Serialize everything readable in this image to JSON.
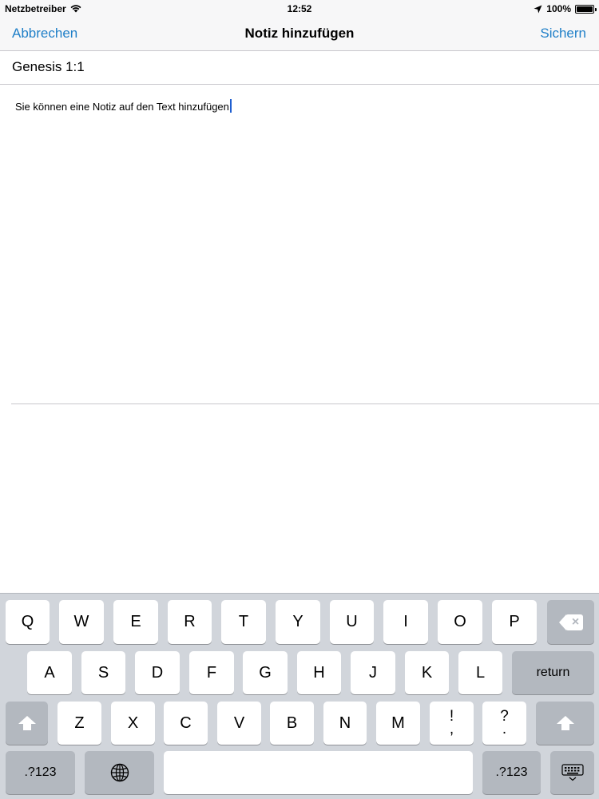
{
  "status_bar": {
    "carrier": "Netzbetreiber",
    "time": "12:52",
    "battery": "100%",
    "battery_level": 1.0
  },
  "nav": {
    "cancel_label": "Abbrechen",
    "title": "Notiz hinzufügen",
    "save_label": "Sichern"
  },
  "reference": "Genesis 1:1",
  "note": {
    "text": "Sie können eine Notiz auf den Text hinzufügen"
  },
  "keyboard": {
    "row1": [
      "Q",
      "W",
      "E",
      "R",
      "T",
      "Y",
      "U",
      "I",
      "O",
      "P"
    ],
    "row2": [
      "A",
      "S",
      "D",
      "F",
      "G",
      "H",
      "J",
      "K",
      "L"
    ],
    "row3": [
      "Z",
      "X",
      "C",
      "V",
      "B",
      "N",
      "M"
    ],
    "punct1_top": "!",
    "punct1_bottom": ",",
    "punct2_top": "?",
    "punct2_bottom": ".",
    "return_label": "return",
    "numbers_label": ".?123"
  },
  "colors": {
    "accent": "#1f7fc8",
    "keyboard_bg": "#d1d5db",
    "key_dark": "#b3b8bf"
  }
}
